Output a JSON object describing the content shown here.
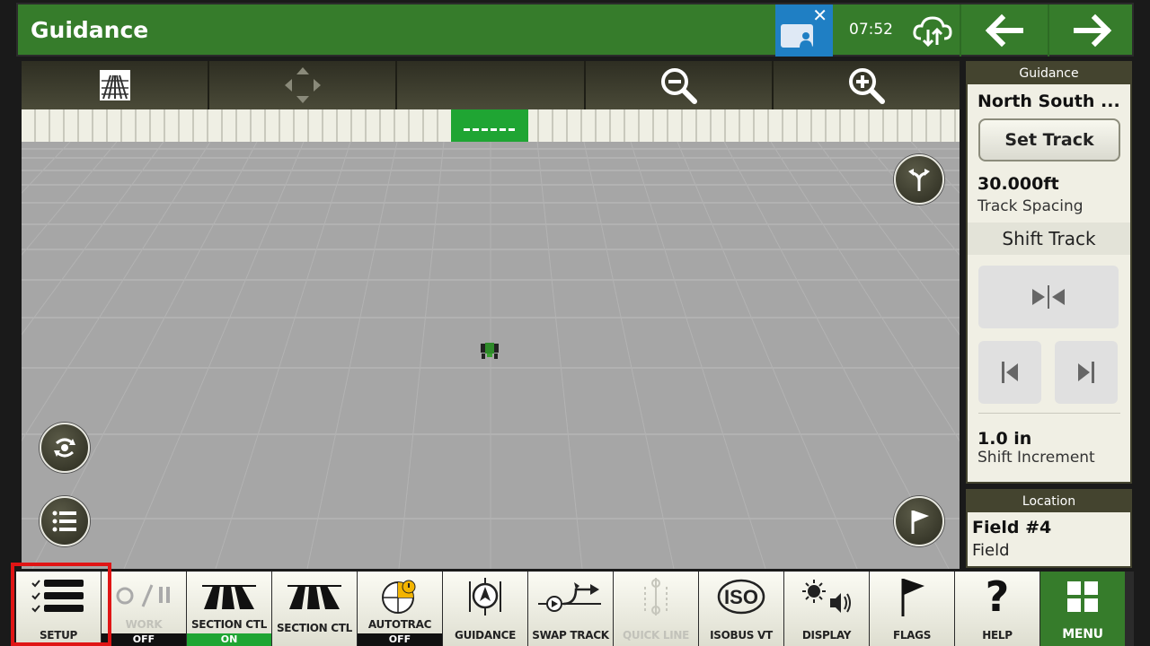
{
  "header": {
    "title": "Guidance",
    "clock": "07:52"
  },
  "map_toolbar": {
    "buttons": [
      "grid-view-icon",
      "pan-arrows-icon",
      "blank",
      "zoom-out-icon",
      "zoom-in-icon"
    ]
  },
  "guidance_panel": {
    "heading": "Guidance",
    "track_name": "North South ...",
    "set_track_label": "Set Track",
    "track_spacing_value": "30.000ft",
    "track_spacing_label": "Track Spacing",
    "shift_track_label": "Shift Track",
    "shift_increment_value": "1.0 in",
    "shift_increment_label": "Shift Increment"
  },
  "location_panel": {
    "heading": "Location",
    "field_name": "Field #4",
    "field_type": "Field"
  },
  "bottom_bar": {
    "setup": "SETUP",
    "work": "WORK",
    "work_status": "OFF",
    "section_ctl_1": "SECTION CTL",
    "section_ctl_1_status": "ON",
    "section_ctl_2": "SECTION CTL",
    "autotrac": "AUTOTRAC",
    "autotrac_status": "OFF",
    "guidance": "GUIDANCE",
    "swap_track": "SWAP TRACK",
    "quick_line": "QUICK LINE",
    "isobus_vt": "ISOBUS VT",
    "display": "DISPLAY",
    "flags": "FLAGS",
    "help": "HELP",
    "menu": "MENU"
  },
  "colors": {
    "header_green": "#367c2b",
    "status_on": "#1fa533",
    "status_off": "#111111",
    "highlight": "#e01515"
  }
}
